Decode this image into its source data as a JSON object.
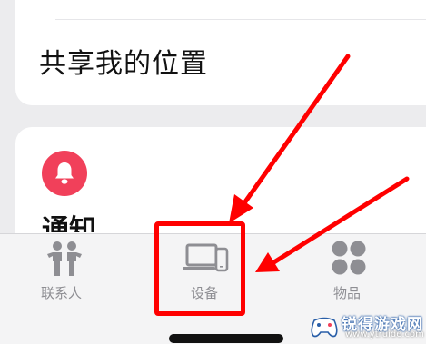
{
  "share_location": {
    "title": "共享我的位置"
  },
  "notifications": {
    "title": "通知",
    "icon": "bell-icon"
  },
  "tabbar": {
    "tabs": [
      {
        "label": "联系人",
        "icon": "people-icon"
      },
      {
        "label": "设备",
        "icon": "devices-icon"
      },
      {
        "label": "物品",
        "icon": "items-grid-icon"
      }
    ]
  },
  "annotation": {
    "color": "#ff0000"
  },
  "watermark": {
    "text": "锐得游戏网",
    "url": "www.ytruide.com"
  },
  "colors": {
    "badge": "#f1405a",
    "tab_inactive": "#8e8e93"
  }
}
